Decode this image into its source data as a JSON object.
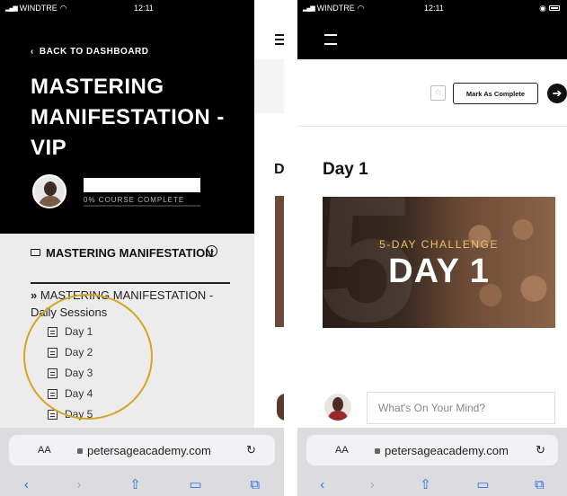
{
  "phone1": {
    "status": {
      "carrier": "WINDTRE",
      "time": "12:11"
    },
    "back_label": "BACK TO DASHBOARD",
    "course_title": "MASTERING MANIFESTATION - VIP",
    "progress_label": "0% COURSE COMPLETE",
    "section_title": "MASTERING MANIFESTATION",
    "subsection_title": "MASTERING MANIFESTATION - Daily Sessions",
    "lessons": [
      "Day 1",
      "Day 2",
      "Day 3",
      "Day 4",
      "Day 5"
    ],
    "peek_letter": "D"
  },
  "phone2": {
    "status": {
      "carrier": "WINDTRE",
      "time": "12:11"
    },
    "mark_complete_label": "Mark As Complete",
    "lesson_title": "Day 1",
    "video": {
      "challenge": "5-DAY CHALLENGE",
      "day": "DAY 1",
      "bg_digit": "5"
    },
    "comment_placeholder": "What's On Your Mind?"
  },
  "browser": {
    "aa_label": "AA",
    "url": "petersageacademy.com"
  },
  "icons": {
    "back": "chevron-left-icon",
    "folder": "folder-icon",
    "toggle": "circle-arrow-icon",
    "lesson": "document-icon",
    "menu": "hamburger-icon",
    "star": "star-icon",
    "next": "arrow-right-circle-icon",
    "reload": "reload-icon",
    "lock": "lock-icon"
  },
  "colors": {
    "highlight": "#d4a520",
    "browser_accent": "#2f6fe0",
    "dark": "#000000"
  }
}
